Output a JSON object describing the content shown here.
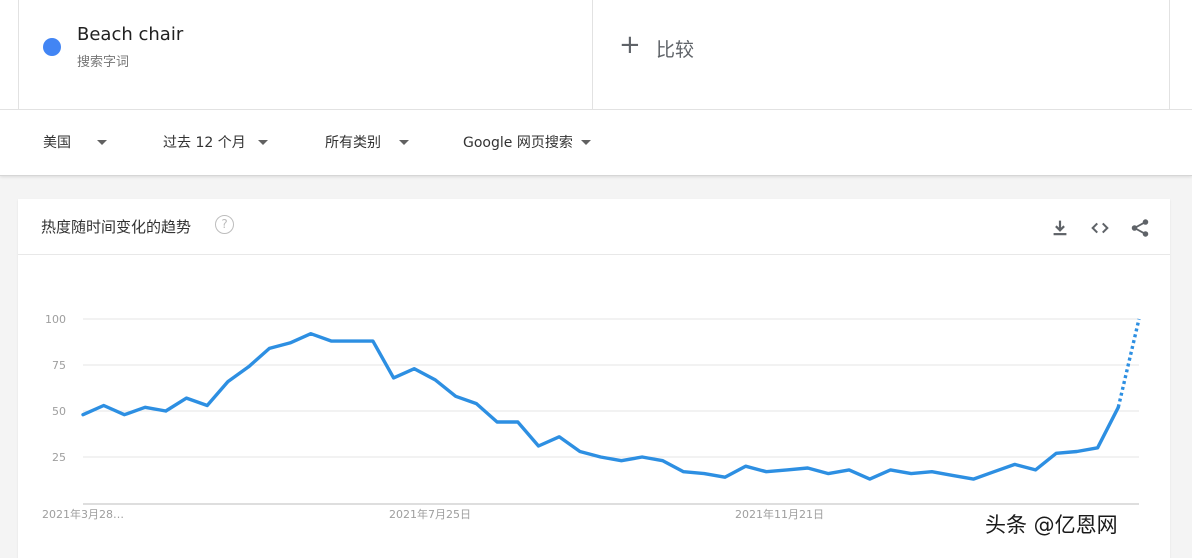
{
  "search_term": {
    "name": "Beach chair",
    "subtitle": "搜索字词",
    "color": "#4285f4"
  },
  "compare": {
    "plus": "+",
    "label": "比较"
  },
  "filters": {
    "region": "美国",
    "period": "过去 12 个月",
    "category": "所有类别",
    "search_type": "Google 网页搜索"
  },
  "panel": {
    "title": "热度随时间变化的趋势",
    "help_icon": "help-circle-icon",
    "download_icon": "download-icon",
    "embed_icon": "embed-code-icon",
    "share_icon": "share-icon"
  },
  "chart_data": {
    "type": "line",
    "title": "",
    "xlabel": "",
    "ylabel": "",
    "ylim": [
      0,
      100
    ],
    "yticks": [
      25,
      50,
      75,
      100
    ],
    "x_tick_labels": [
      "2021年3月28…",
      "2021年7月25日",
      "2021年11月21日"
    ],
    "grid": true,
    "line_color": "#2d8fe2",
    "series": [
      {
        "values": [
          48,
          53,
          48,
          52,
          50,
          57,
          53,
          66,
          74,
          84,
          87,
          92,
          88,
          88,
          88,
          68,
          73,
          67,
          58,
          54,
          44,
          44,
          31,
          36,
          28,
          25,
          23,
          25,
          23,
          17,
          16,
          14,
          20,
          17,
          18,
          19,
          16,
          18,
          13,
          18,
          16,
          17,
          15,
          13,
          17,
          21,
          18,
          27,
          28,
          30,
          52
        ],
        "partial_next": 100
      }
    ]
  },
  "watermark": "头条 @亿恩网"
}
